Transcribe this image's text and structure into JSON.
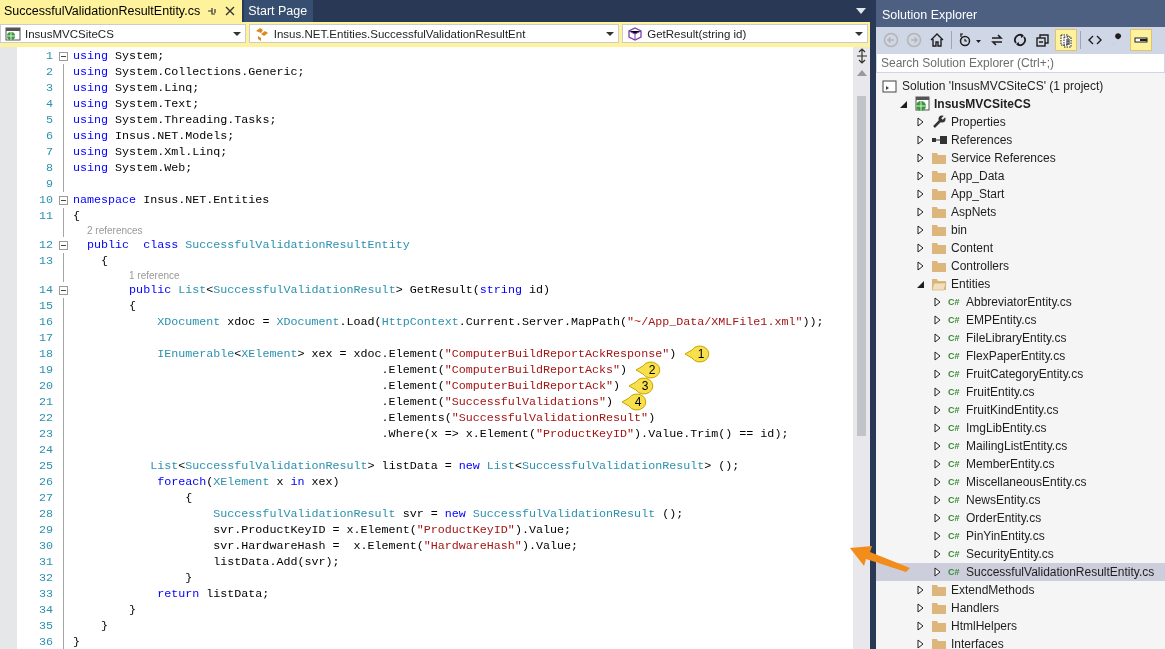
{
  "tabs": [
    {
      "label": "SuccessfulValidationResultEntity.cs",
      "selected": true
    },
    {
      "label": "Start Page",
      "selected": false
    }
  ],
  "navigation": [
    {
      "kind": "project",
      "text": "InsusMVCSiteCS"
    },
    {
      "kind": "class",
      "text": "Insus.NET.Entities.SuccessfulValidationResultEnt"
    },
    {
      "kind": "member",
      "text": "GetResult(string id)"
    }
  ],
  "code": [
    {
      "number": "1",
      "foldable": true,
      "tokens": [
        {
          "kind": "keyword",
          "text": "using"
        },
        {
          "kind": "plain",
          "text": " System;"
        }
      ]
    },
    {
      "number": "2",
      "tokens": [
        {
          "kind": "keyword",
          "text": "using"
        },
        {
          "kind": "plain",
          "text": " System.Collections.Generic;"
        }
      ]
    },
    {
      "number": "3",
      "tokens": [
        {
          "kind": "keyword",
          "text": "using"
        },
        {
          "kind": "plain",
          "text": " System.Linq;"
        }
      ]
    },
    {
      "number": "4",
      "tokens": [
        {
          "kind": "keyword",
          "text": "using"
        },
        {
          "kind": "plain",
          "text": " System.Text;"
        }
      ]
    },
    {
      "number": "5",
      "tokens": [
        {
          "kind": "keyword",
          "text": "using"
        },
        {
          "kind": "plain",
          "text": " System.Threading.Tasks;"
        }
      ]
    },
    {
      "number": "6",
      "tokens": [
        {
          "kind": "keyword",
          "text": "using"
        },
        {
          "kind": "plain",
          "text": " Insus.NET.Models;"
        }
      ]
    },
    {
      "number": "7",
      "tokens": [
        {
          "kind": "keyword",
          "text": "using"
        },
        {
          "kind": "plain",
          "text": " System.Xml.Linq;"
        }
      ]
    },
    {
      "number": "8",
      "tokens": [
        {
          "kind": "keyword",
          "text": "using"
        },
        {
          "kind": "plain",
          "text": " System.Web;"
        }
      ]
    },
    {
      "number": "9"
    },
    {
      "number": "10",
      "foldable": true,
      "tokens": [
        {
          "kind": "keyword",
          "text": "namespace"
        },
        {
          "kind": "plain",
          "text": " Insus.NET.Entities"
        }
      ]
    },
    {
      "number": "11",
      "tokens": [
        {
          "kind": "plain",
          "text": "{"
        }
      ]
    },
    {
      "lens": "2 references",
      "number": "12",
      "foldable": true,
      "tokens": [
        {
          "kind": "keyword",
          "text": "  public"
        },
        {
          "kind": "keyword",
          "text": "  class"
        },
        {
          "kind": "type",
          "text": " SuccessfulValidationResultEntity"
        }
      ]
    },
    {
      "number": "13",
      "tokens": [
        {
          "kind": "plain",
          "text": "    {"
        }
      ]
    },
    {
      "lens": "1 reference",
      "number": "14",
      "foldable": true,
      "tokens": [
        {
          "kind": "keyword",
          "text": "        public"
        },
        {
          "kind": "type",
          "text": " List"
        },
        {
          "kind": "plain",
          "text": "<"
        },
        {
          "kind": "type",
          "text": "SuccessfulValidationResult"
        },
        {
          "kind": "plain",
          "text": "> GetResult("
        },
        {
          "kind": "keyword",
          "text": "string"
        },
        {
          "kind": "plain",
          "text": " id)"
        }
      ]
    },
    {
      "number": "15",
      "tokens": [
        {
          "kind": "plain",
          "text": "        {"
        }
      ]
    },
    {
      "number": "16",
      "tokens": [
        {
          "kind": "type",
          "text": "            XDocument"
        },
        {
          "kind": "plain",
          "text": " xdoc = "
        },
        {
          "kind": "type",
          "text": "XDocument"
        },
        {
          "kind": "plain",
          "text": ".Load("
        },
        {
          "kind": "type",
          "text": "HttpContext"
        },
        {
          "kind": "plain",
          "text": ".Current.Server.MapPath("
        },
        {
          "kind": "string",
          "text": "\"~/App_Data/XMLFile1.xml\""
        },
        {
          "kind": "plain",
          "text": "));"
        }
      ]
    },
    {
      "number": "17"
    },
    {
      "number": "18",
      "callout": "1",
      "tokens": [
        {
          "kind": "type",
          "text": "            IEnumerable"
        },
        {
          "kind": "plain",
          "text": "<"
        },
        {
          "kind": "type",
          "text": "XElement"
        },
        {
          "kind": "plain",
          "text": "> xex = xdoc.Element("
        },
        {
          "kind": "string",
          "text": "\"ComputerBuildReportAckResponse\""
        },
        {
          "kind": "plain",
          "text": ")"
        }
      ]
    },
    {
      "number": "19",
      "callout": "2",
      "tokens": [
        {
          "kind": "plain",
          "text": "                                            .Element("
        },
        {
          "kind": "string",
          "text": "\"ComputerBuildReportAcks\""
        },
        {
          "kind": "plain",
          "text": ")"
        }
      ]
    },
    {
      "number": "20",
      "callout": "3",
      "tokens": [
        {
          "kind": "plain",
          "text": "                                            .Element("
        },
        {
          "kind": "string",
          "text": "\"ComputerBuildReportAck\""
        },
        {
          "kind": "plain",
          "text": ")"
        }
      ]
    },
    {
      "number": "21",
      "callout": "4",
      "tokens": [
        {
          "kind": "plain",
          "text": "                                            .Element("
        },
        {
          "kind": "string",
          "text": "\"SuccessfulValidations\""
        },
        {
          "kind": "plain",
          "text": ")"
        }
      ]
    },
    {
      "number": "22",
      "tokens": [
        {
          "kind": "plain",
          "text": "                                            .Elements("
        },
        {
          "kind": "string",
          "text": "\"SuccessfulValidationResult\""
        },
        {
          "kind": "plain",
          "text": ")"
        }
      ]
    },
    {
      "number": "23",
      "tokens": [
        {
          "kind": "plain",
          "text": "                                            .Where(x => x.Element("
        },
        {
          "kind": "string",
          "text": "\"ProductKeyID\""
        },
        {
          "kind": "plain",
          "text": ").Value.Trim() == id);"
        }
      ]
    },
    {
      "number": "24"
    },
    {
      "number": "25",
      "tokens": [
        {
          "kind": "type",
          "text": "           List"
        },
        {
          "kind": "plain",
          "text": "<"
        },
        {
          "kind": "type",
          "text": "SuccessfulValidationResult"
        },
        {
          "kind": "plain",
          "text": "> listData = "
        },
        {
          "kind": "keyword",
          "text": "new"
        },
        {
          "kind": "type",
          "text": " List"
        },
        {
          "kind": "plain",
          "text": "<"
        },
        {
          "kind": "type",
          "text": "SuccessfulValidationResult"
        },
        {
          "kind": "plain",
          "text": "> ();"
        }
      ]
    },
    {
      "number": "26",
      "tokens": [
        {
          "kind": "keyword",
          "text": "            foreach"
        },
        {
          "kind": "plain",
          "text": "("
        },
        {
          "kind": "type",
          "text": "XElement"
        },
        {
          "kind": "plain",
          "text": " x "
        },
        {
          "kind": "keyword",
          "text": "in"
        },
        {
          "kind": "plain",
          "text": " xex)"
        }
      ]
    },
    {
      "number": "27",
      "tokens": [
        {
          "kind": "plain",
          "text": "                {"
        }
      ]
    },
    {
      "number": "28",
      "tokens": [
        {
          "kind": "type",
          "text": "                    SuccessfulValidationResult"
        },
        {
          "kind": "plain",
          "text": " svr = "
        },
        {
          "kind": "keyword",
          "text": "new"
        },
        {
          "kind": "type",
          "text": " SuccessfulValidationResult"
        },
        {
          "kind": "plain",
          "text": " ();"
        }
      ]
    },
    {
      "number": "29",
      "tokens": [
        {
          "kind": "plain",
          "text": "                    svr.ProductKeyID = x.Element("
        },
        {
          "kind": "string",
          "text": "\"ProductKeyID\""
        },
        {
          "kind": "plain",
          "text": ").Value;"
        }
      ]
    },
    {
      "number": "30",
      "tokens": [
        {
          "kind": "plain",
          "text": "                    svr.HardwareHash =  x.Element("
        },
        {
          "kind": "string",
          "text": "\"HardwareHash\""
        },
        {
          "kind": "plain",
          "text": ").Value;"
        }
      ]
    },
    {
      "number": "31",
      "tokens": [
        {
          "kind": "plain",
          "text": "                    listData.Add(svr);"
        }
      ]
    },
    {
      "number": "32",
      "tokens": [
        {
          "kind": "plain",
          "text": "                }"
        }
      ]
    },
    {
      "number": "33",
      "tokens": [
        {
          "kind": "keyword",
          "text": "            return"
        },
        {
          "kind": "plain",
          "text": " listData;"
        }
      ]
    },
    {
      "number": "34",
      "tokens": [
        {
          "kind": "plain",
          "text": "        }"
        }
      ]
    },
    {
      "number": "35",
      "tokens": [
        {
          "kind": "plain",
          "text": "    }"
        }
      ]
    },
    {
      "number": "36",
      "tokens": [
        {
          "kind": "plain",
          "text": "}"
        }
      ]
    }
  ],
  "solution_explorer": {
    "title": "Solution Explorer",
    "toolbar": [
      {
        "kind": "back",
        "disabled": true
      },
      {
        "kind": "forward",
        "disabled": true
      },
      {
        "kind": "home",
        "disabled": false
      },
      {
        "kind": "history",
        "disabled": false
      },
      {
        "kind": "sync",
        "disabled": false
      },
      {
        "kind": "refresh",
        "disabled": false
      },
      {
        "kind": "collapse",
        "disabled": false
      },
      {
        "kind": "show-all",
        "disabled": false,
        "on": true
      },
      {
        "kind": "code",
        "disabled": false
      },
      {
        "kind": "properties",
        "disabled": false
      },
      {
        "kind": "preview",
        "disabled": false,
        "on": true
      }
    ],
    "search": {
      "placeholder": "Search Solution Explorer (Ctrl+;)"
    },
    "tree": [
      {
        "kind": "solution",
        "label": "Solution 'InsusMVCSiteCS' (1 project)",
        "selected": false,
        "children": [
          {
            "kind": "project",
            "label": "InsusMVCSiteCS",
            "expanded": true,
            "selected": false,
            "children": [
              {
                "kind": "properties",
                "label": "Properties",
                "expanded": false,
                "selected": false
              },
              {
                "kind": "references",
                "label": "References",
                "expanded": false,
                "selected": false
              },
              {
                "kind": "folder",
                "label": "Service References",
                "expanded": false,
                "selected": false
              },
              {
                "kind": "folder",
                "label": "App_Data",
                "expanded": false,
                "selected": false
              },
              {
                "kind": "folder",
                "label": "App_Start",
                "expanded": false,
                "selected": false
              },
              {
                "kind": "folder",
                "label": "AspNets",
                "expanded": false,
                "selected": false
              },
              {
                "kind": "folder",
                "label": "bin",
                "expanded": false,
                "selected": false
              },
              {
                "kind": "folder",
                "label": "Content",
                "expanded": false,
                "selected": false
              },
              {
                "kind": "folder",
                "label": "Controllers",
                "expanded": false,
                "selected": false
              },
              {
                "kind": "folder",
                "label": "Entities",
                "expanded": true,
                "selected": false,
                "children": [
                  {
                    "kind": "cs",
                    "icon_text": "C#",
                    "label": "AbbreviatorEntity.cs",
                    "expanded": false,
                    "selected": false
                  },
                  {
                    "kind": "cs",
                    "icon_text": "C#",
                    "label": "EMPEntity.cs",
                    "expanded": false,
                    "selected": false
                  },
                  {
                    "kind": "cs",
                    "icon_text": "C#",
                    "label": "FileLibraryEntity.cs",
                    "expanded": false,
                    "selected": false
                  },
                  {
                    "kind": "cs",
                    "icon_text": "C#",
                    "label": "FlexPaperEntity.cs",
                    "expanded": false,
                    "selected": false
                  },
                  {
                    "kind": "cs",
                    "icon_text": "C#",
                    "label": "FruitCategoryEntity.cs",
                    "expanded": false,
                    "selected": false
                  },
                  {
                    "kind": "cs",
                    "icon_text": "C#",
                    "label": "FruitEntity.cs",
                    "expanded": false,
                    "selected": false
                  },
                  {
                    "kind": "cs",
                    "icon_text": "C#",
                    "label": "FruitKindEntity.cs",
                    "expanded": false,
                    "selected": false
                  },
                  {
                    "kind": "cs",
                    "icon_text": "C#",
                    "label": "ImgLibEntity.cs",
                    "expanded": false,
                    "selected": false
                  },
                  {
                    "kind": "cs",
                    "icon_text": "C#",
                    "label": "MailingListEntity.cs",
                    "expanded": false,
                    "selected": false
                  },
                  {
                    "kind": "cs",
                    "icon_text": "C#",
                    "label": "MemberEntity.cs",
                    "expanded": false,
                    "selected": false
                  },
                  {
                    "kind": "cs",
                    "icon_text": "C#",
                    "label": "MiscellaneousEntity.cs",
                    "expanded": false,
                    "selected": false
                  },
                  {
                    "kind": "cs",
                    "icon_text": "C#",
                    "label": "NewsEntity.cs",
                    "expanded": false,
                    "selected": false
                  },
                  {
                    "kind": "cs",
                    "icon_text": "C#",
                    "label": "OrderEntity.cs",
                    "expanded": false,
                    "selected": false
                  },
                  {
                    "kind": "cs",
                    "icon_text": "C#",
                    "label": "PinYinEntity.cs",
                    "expanded": false,
                    "selected": false
                  },
                  {
                    "kind": "cs",
                    "icon_text": "C#",
                    "label": "SecurityEntity.cs",
                    "expanded": false,
                    "selected": false
                  },
                  {
                    "kind": "cs",
                    "icon_text": "C#",
                    "label": "SuccessfulValidationResultEntity.cs",
                    "expanded": false,
                    "selected": true
                  }
                ]
              },
              {
                "kind": "folder",
                "label": "ExtendMethods",
                "expanded": false,
                "selected": false
              },
              {
                "kind": "folder",
                "label": "Handlers",
                "expanded": false,
                "selected": false
              },
              {
                "kind": "folder",
                "label": "HtmlHelpers",
                "expanded": false,
                "selected": false
              },
              {
                "kind": "folder",
                "label": "Interfaces",
                "expanded": false,
                "selected": false
              }
            ]
          }
        ]
      }
    ]
  }
}
